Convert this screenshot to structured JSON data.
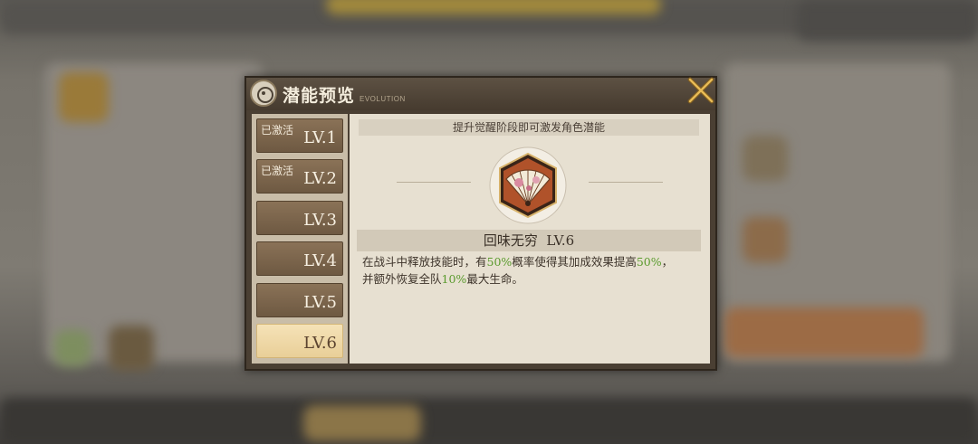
{
  "dialog": {
    "title": "潜能预览",
    "subtitle": "EVOLUTION"
  },
  "levels": [
    {
      "status": "已激活",
      "label": "LV.1",
      "selected": false
    },
    {
      "status": "已激活",
      "label": "LV.2",
      "selected": false
    },
    {
      "status": "",
      "label": "LV.3",
      "selected": false
    },
    {
      "status": "",
      "label": "LV.4",
      "selected": false
    },
    {
      "status": "",
      "label": "LV.5",
      "selected": false
    },
    {
      "status": "",
      "label": "LV.6",
      "selected": true
    }
  ],
  "content": {
    "hint": "提升觉醒阶段即可激发角色潜能",
    "skill_name": "回味无穷",
    "skill_level": "LV.6",
    "description": {
      "line1_a": "在战斗中释放技能时，有",
      "val1": "50%",
      "line1_b": "概率使得其加成效果提高",
      "val2": "50%",
      "line1_c": "，",
      "line2_a": "并额外恢复全队",
      "val3": "10%",
      "line2_b": "最大生命。"
    }
  },
  "colors": {
    "highlight_green": "#5a9a2d",
    "selected_tab": "#f5e2b7",
    "close_accent": "#e0b14a"
  },
  "icons": {
    "close": "close-x-icon",
    "title_emblem": "circle-emblem-icon",
    "skill": "folding-fan-icon"
  }
}
